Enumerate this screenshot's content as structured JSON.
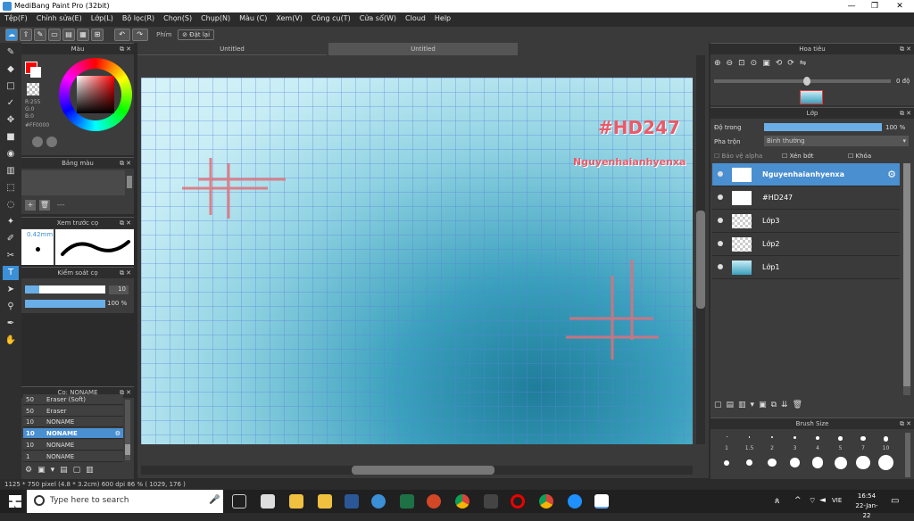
{
  "window": {
    "title": "MediBang Paint Pro (32bit)",
    "minimize": "—",
    "maximize": "❐",
    "close": "✕"
  },
  "menu": [
    "Tệp(F)",
    "Chỉnh sửa(E)",
    "Lớp(L)",
    "Bộ lọc(R)",
    "Chọn(S)",
    "Chụp(N)",
    "Màu (C)",
    "Xem(V)",
    "Công cụ(T)",
    "Cửa sổ(W)",
    "Cloud",
    "Help"
  ],
  "toolbar": {
    "shortcut_label": "Phím",
    "reset_label": "Đặt lại"
  },
  "color_panel": {
    "title": "Màu",
    "rgb": [
      "R:255",
      "G:0",
      "B:0"
    ],
    "hex": "#FF0000",
    "primary": "#ff0000"
  },
  "palette_panel": {
    "title": "Bảng màu",
    "dash": "---"
  },
  "brush_preview": {
    "title": "Xem trước cọ",
    "size": "0.42mm"
  },
  "brush_control": {
    "title": "Kiểm soát cọ",
    "size_value": "10",
    "opacity_value": "100 %"
  },
  "brush_list": {
    "title": "Cọ: NONAME",
    "items": [
      {
        "size": "50",
        "name": "Eraser (Soft)"
      },
      {
        "size": "50",
        "name": "Eraser"
      },
      {
        "size": "10",
        "name": "NONAME"
      },
      {
        "size": "10",
        "name": "NONAME",
        "selected": true
      },
      {
        "size": "10",
        "name": "NONAME"
      },
      {
        "size": "1",
        "name": "NONAME"
      }
    ]
  },
  "tabs": [
    "Untitled",
    "Untitled"
  ],
  "canvas_text": {
    "tag": "#HD247",
    "author": "Nguyenhaianhyenxa"
  },
  "navigator": {
    "title": "Hoa tiêu",
    "angle": "0 độ"
  },
  "layer_panel": {
    "title": "Lớp",
    "opacity_label": "Độ trong",
    "opacity_value": "100 %",
    "blend_label": "Pha trộn",
    "blend_value": "Bình thường",
    "protect_alpha": "Bảo vệ alpha",
    "clip": "Xén bớt",
    "lock": "Khóa",
    "layers": [
      {
        "name": "Nguyenhaianhyenxa",
        "selected": true
      },
      {
        "name": "#HD247"
      },
      {
        "name": "Lớp3"
      },
      {
        "name": "Lớp2"
      },
      {
        "name": "Lớp1"
      }
    ]
  },
  "brush_size": {
    "title": "Brush Size",
    "labels": [
      "1",
      "1.5",
      "2",
      "3",
      "4",
      "5",
      "7",
      "10"
    ]
  },
  "status": {
    "text": "1125 * 750 pixel   (4.8 * 3.2cm)   600 dpi   86 %   ( 1029, 176 )"
  },
  "taskbar": {
    "search_placeholder": "Type here to search",
    "lang": "VIE",
    "time": "16:54",
    "date": "22-Jan-22"
  }
}
